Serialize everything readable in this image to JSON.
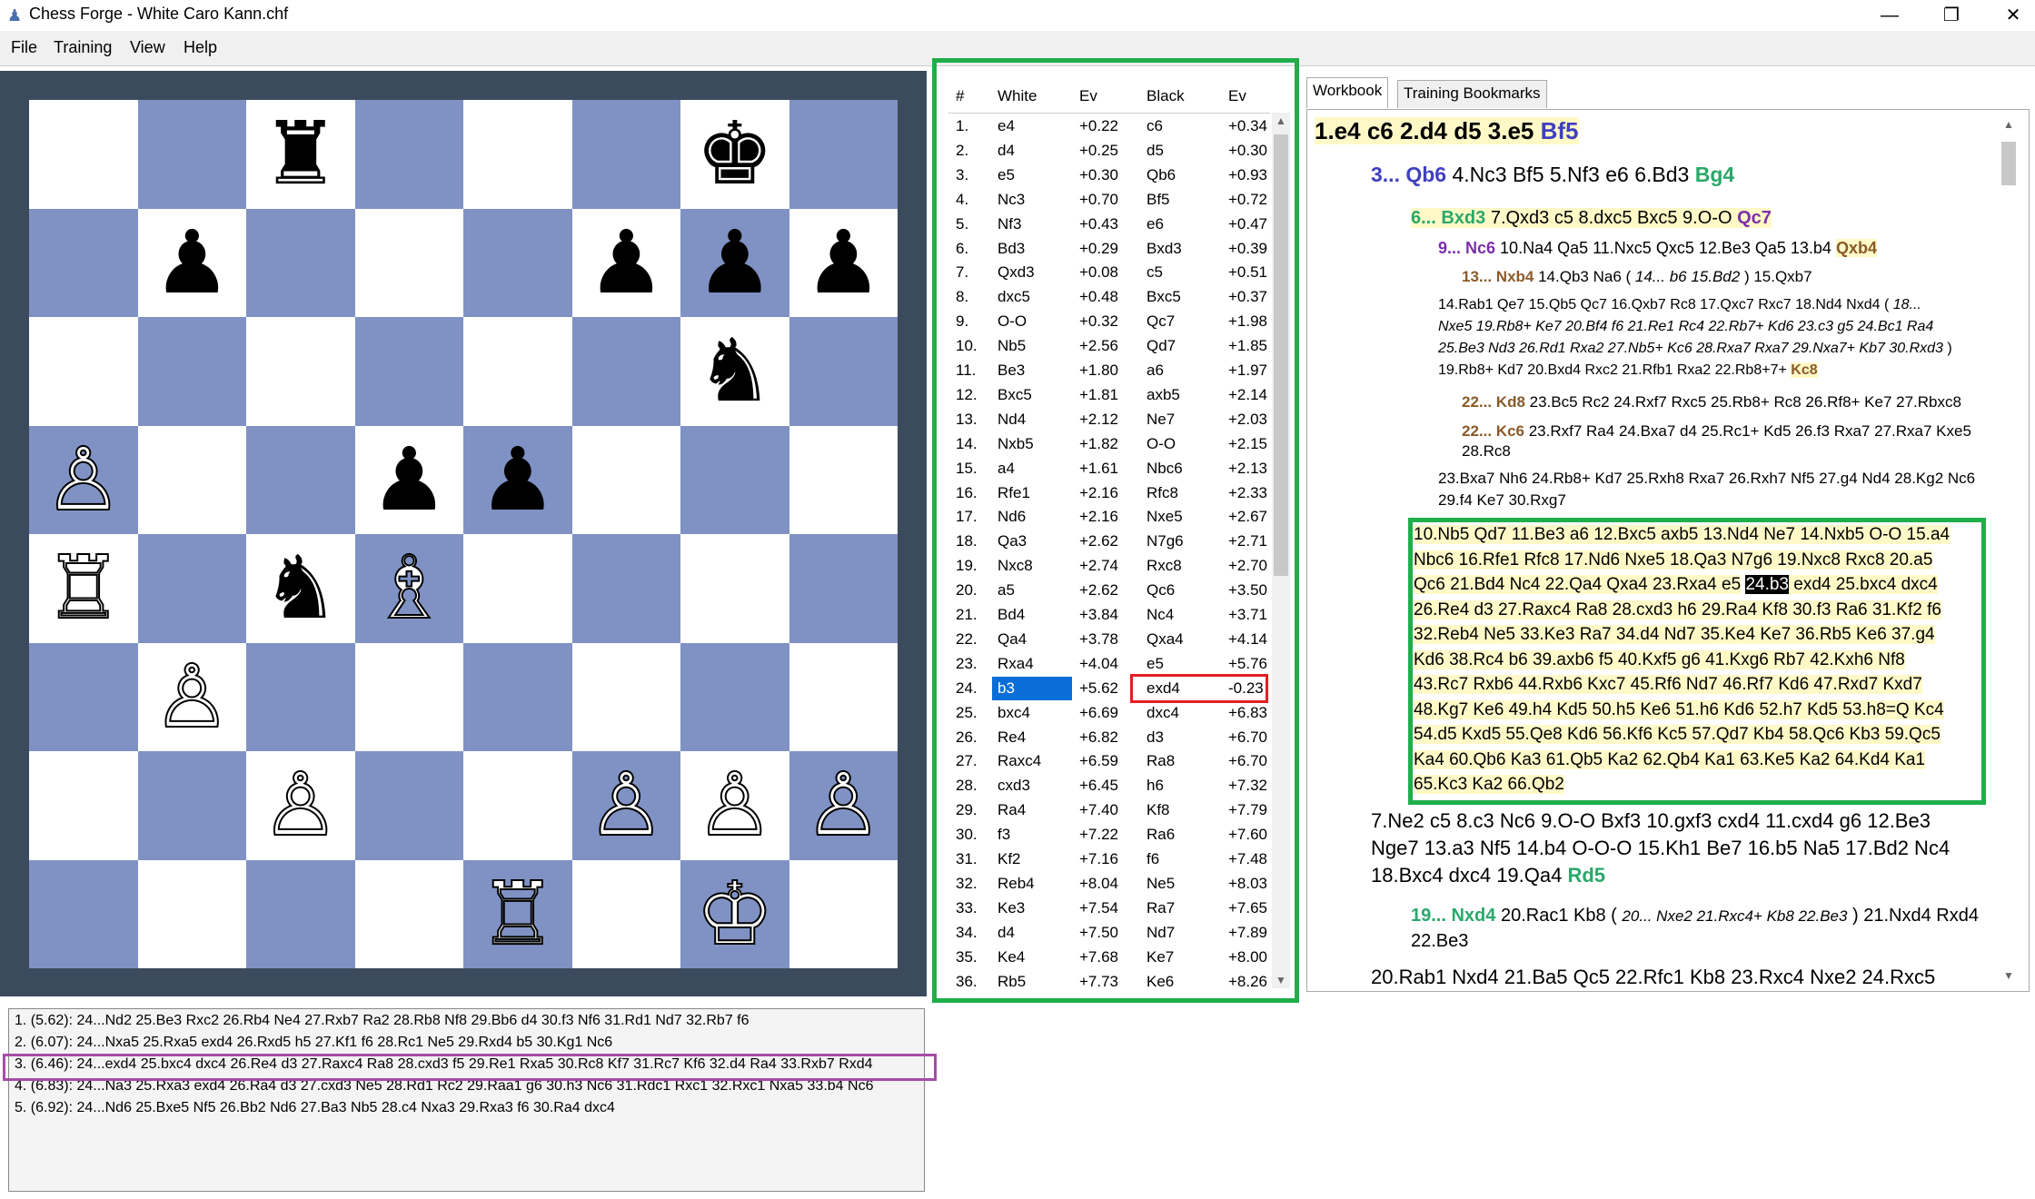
{
  "window": {
    "title": "Chess Forge - White Caro Kann.chf",
    "buttons": {
      "minimize": "—",
      "maximize": "❐",
      "close": "✕"
    }
  },
  "menu": [
    "File",
    "Training",
    "View",
    "Help"
  ],
  "board": {
    "light_color": "#ffffff",
    "dark_color": "#8092c4",
    "pieces": [
      {
        "sq": "c8",
        "glyph": "♜",
        "color": "b",
        "name": "black-rook"
      },
      {
        "sq": "g8",
        "glyph": "♚",
        "color": "b",
        "name": "black-king"
      },
      {
        "sq": "b7",
        "glyph": "♟",
        "color": "b",
        "name": "black-pawn"
      },
      {
        "sq": "f7",
        "glyph": "♟",
        "color": "b",
        "name": "black-pawn"
      },
      {
        "sq": "g7",
        "glyph": "♟",
        "color": "b",
        "name": "black-pawn"
      },
      {
        "sq": "h7",
        "glyph": "♟",
        "color": "b",
        "name": "black-pawn"
      },
      {
        "sq": "g6",
        "glyph": "♞",
        "color": "b",
        "name": "black-knight"
      },
      {
        "sq": "a5",
        "glyph": "♙",
        "color": "w",
        "name": "white-pawn"
      },
      {
        "sq": "d5",
        "glyph": "♟",
        "color": "b",
        "name": "black-pawn"
      },
      {
        "sq": "e5",
        "glyph": "♟",
        "color": "b",
        "name": "black-pawn"
      },
      {
        "sq": "a4",
        "glyph": "♖",
        "color": "w",
        "name": "white-rook"
      },
      {
        "sq": "c4",
        "glyph": "♞",
        "color": "b",
        "name": "black-knight"
      },
      {
        "sq": "d4",
        "glyph": "♗",
        "color": "w",
        "name": "white-bishop"
      },
      {
        "sq": "b3",
        "glyph": "♙",
        "color": "w",
        "name": "white-pawn"
      },
      {
        "sq": "c2",
        "glyph": "♙",
        "color": "w",
        "name": "white-pawn"
      },
      {
        "sq": "f2",
        "glyph": "♙",
        "color": "w",
        "name": "white-pawn"
      },
      {
        "sq": "g2",
        "glyph": "♙",
        "color": "w",
        "name": "white-pawn"
      },
      {
        "sq": "h2",
        "glyph": "♙",
        "color": "w",
        "name": "white-pawn"
      },
      {
        "sq": "e1",
        "glyph": "♖",
        "color": "w",
        "name": "white-rook"
      },
      {
        "sq": "g1",
        "glyph": "♔",
        "color": "w",
        "name": "white-king"
      }
    ]
  },
  "engine_lines": [
    "1. (5.62): 24...Nd2 25.Be3 Rxc2 26.Rb4 Ne4 27.Rxb7 Ra2 28.Rb8 Nf8 29.Bb6 d4 30.f3 Nf6 31.Rd1 Nd7 32.Rb7 f6",
    "2. (6.07): 24...Nxa5 25.Rxa5 exd4 26.Rxd5 h5 27.Kf1 f6 28.Rc1 Ne5 29.Rxd4 b5 30.Kg1 Nc6",
    "3. (6.46): 24...exd4 25.bxc4 dxc4 26.Re4 d3 27.Raxc4 Ra8 28.cxd3 f5 29.Re1 Rxa5 30.Rc8 Kf7 31.Rc7 Kf6 32.d4 Ra4 33.Rxb7 Rxd4",
    "4. (6.83): 24...Na3 25.Rxa3 exd4 26.Ra4 d3 27.cxd3 Ne5 28.Rd1 Rc2 29.Raa1 g6 30.h3 Nc6 31.Rdc1 Rxc1 32.Rxc1 Nxa5 33.b4 Nc6",
    "5. (6.92): 24...Nd6 25.Bxe5 Nf5 26.Bb2 Nd6 27.Ba3 Nb5 28.c4 Nxa3 29.Rxa3 f6 30.Ra4 dxc4"
  ],
  "moves_table": {
    "headers": [
      "#",
      "White",
      "Ev",
      "Black",
      "Ev"
    ],
    "rows": [
      [
        "1.",
        "e4",
        "+0.22",
        "c6",
        "+0.34"
      ],
      [
        "2.",
        "d4",
        "+0.25",
        "d5",
        "+0.30"
      ],
      [
        "3.",
        "e5",
        "+0.30",
        "Qb6",
        "+0.93"
      ],
      [
        "4.",
        "Nc3",
        "+0.70",
        "Bf5",
        "+0.72"
      ],
      [
        "5.",
        "Nf3",
        "+0.43",
        "e6",
        "+0.47"
      ],
      [
        "6.",
        "Bd3",
        "+0.29",
        "Bxd3",
        "+0.39"
      ],
      [
        "7.",
        "Qxd3",
        "+0.08",
        "c5",
        "+0.51"
      ],
      [
        "8.",
        "dxc5",
        "+0.48",
        "Bxc5",
        "+0.37"
      ],
      [
        "9.",
        "O-O",
        "+0.32",
        "Qc7",
        "+1.98"
      ],
      [
        "10.",
        "Nb5",
        "+2.56",
        "Qd7",
        "+1.85"
      ],
      [
        "11.",
        "Be3",
        "+1.80",
        "a6",
        "+1.97"
      ],
      [
        "12.",
        "Bxc5",
        "+1.81",
        "axb5",
        "+2.14"
      ],
      [
        "13.",
        "Nd4",
        "+2.12",
        "Ne7",
        "+2.03"
      ],
      [
        "14.",
        "Nxb5",
        "+1.82",
        "O-O",
        "+2.15"
      ],
      [
        "15.",
        "a4",
        "+1.61",
        "Nbc6",
        "+2.13"
      ],
      [
        "16.",
        "Rfe1",
        "+2.16",
        "Rfc8",
        "+2.33"
      ],
      [
        "17.",
        "Nd6",
        "+2.16",
        "Nxe5",
        "+2.67"
      ],
      [
        "18.",
        "Qa3",
        "+2.62",
        "N7g6",
        "+2.71"
      ],
      [
        "19.",
        "Nxc8",
        "+2.74",
        "Rxc8",
        "+2.70"
      ],
      [
        "20.",
        "a5",
        "+2.62",
        "Qc6",
        "+3.50"
      ],
      [
        "21.",
        "Bd4",
        "+3.84",
        "Nc4",
        "+3.71"
      ],
      [
        "22.",
        "Qa4",
        "+3.78",
        "Qxa4",
        "+4.14"
      ],
      [
        "23.",
        "Rxa4",
        "+4.04",
        "e5",
        "+5.76"
      ],
      [
        "24.",
        "b3",
        "+5.62",
        "exd4",
        "-0.23"
      ],
      [
        "25.",
        "bxc4",
        "+6.69",
        "dxc4",
        "+6.83"
      ],
      [
        "26.",
        "Re4",
        "+6.82",
        "d3",
        "+6.70"
      ],
      [
        "27.",
        "Raxc4",
        "+6.59",
        "Ra8",
        "+6.70"
      ],
      [
        "28.",
        "cxd3",
        "+6.45",
        "h6",
        "+7.32"
      ],
      [
        "29.",
        "Ra4",
        "+7.40",
        "Kf8",
        "+7.79"
      ],
      [
        "30.",
        "f3",
        "+7.22",
        "Ra6",
        "+7.60"
      ],
      [
        "31.",
        "Kf2",
        "+7.16",
        "f6",
        "+7.48"
      ],
      [
        "32.",
        "Reb4",
        "+8.04",
        "Ne5",
        "+8.03"
      ],
      [
        "33.",
        "Ke3",
        "+7.54",
        "Ra7",
        "+7.65"
      ],
      [
        "34.",
        "d4",
        "+7.50",
        "Nd7",
        "+7.89"
      ],
      [
        "35.",
        "Ke4",
        "+7.68",
        "Ke7",
        "+8.00"
      ],
      [
        "36.",
        "Rb5",
        "+7.73",
        "Ke6",
        "+8.26"
      ]
    ],
    "selected_row": 24,
    "selected_color": "#0a6ed8"
  },
  "tabs": [
    "Workbook",
    "Training Bookmarks"
  ],
  "workbook": {
    "line1_main": "1.e4 c6 2.d4 d5 3.e5 ",
    "line1_tail": "Bf5",
    "line2_head": "3... Qb6",
    "line2_mid": " 4.Nc3 Bf5 5.Nf3 e6 6.Bd3 ",
    "line2_tail": "Bg4",
    "line3_head": "6... Bxd3",
    "line3_mid": " 7.Qxd3 c5 8.dxc5 Bxc5 9.O-O ",
    "line3_tail": "Qc7",
    "line4_head": "9... Nc6",
    "line4_mid": " 10.Na4 Qa5 11.Nxc5 Qxc5 12.Be3 Qa5 13.b4 ",
    "line4_tail": "Qxb4",
    "line5_head": "13... Nxb4",
    "line5_mid": " 14.Qb3 Na6 ( ",
    "line5_it": "14... b6 15.Bd2",
    "line5_end": " ) 15.Qxb7",
    "line6": "14.Rab1 Qe7 15.Qb5 Qc7 16.Qxb7 Rc8 17.Qxc7 Rxc7 18.Nd4 Nxd4 ( ",
    "line6_it": "18...",
    "line7_it": "Nxe5 19.Rb8+ Ke7 20.Bf4 f6 21.Re1 Rc4 22.Rb7+ Kd6 23.c3 g5 24.Bc1 Ra4",
    "line8_it": "25.Be3 Nd3 26.Rd1 Rxa2 27.Nb5+ Kc6 28.Rxa7 Rxa7 29.Nxa7+ Kb7 30.Rxd3",
    "line8_end": " )",
    "line9_mid": "19.Rb8+ Kd7 20.Bxd4 Rxc2 21.Rfb1 Rxa2 22.Rb8+7+ ",
    "line9_tail": "Kc8",
    "line10_head": "22... Kd8",
    "line10_mid": " 23.Bc5 Rc2 24.Rxf7 Rxc5 25.Rb8+ Rc8 26.Rf8+ Ke7 27.Rbxc8",
    "line11_head": "22... Kc6",
    "line11_mid": " 23.Rxf7 Ra4 24.Bxa7 d4 25.Rc1+ Kd5 26.f3 Rxa7 27.Rxa7 Kxe5",
    "line12": "28.Rc8",
    "line13": "23.Bxa7 Nh6 24.Rb8+ Kd7 25.Rxh8 Rxa7 26.Rxh7 Nf5 27.g4 Nd4 28.Kg2 Nc6",
    "line14": "29.f4 Ke7 30.Rxg7",
    "main_lines": [
      "10.Nb5 Qd7 11.Be3 a6 12.Bxc5 axb5 13.Nd4 Ne7 14.Nxb5 O-O 15.a4",
      "Nbc6 16.Rfe1 Rfc8 17.Nd6 Nxe5 18.Qa3 N7g6 19.Nxc8 Rxc8 20.a5",
      "Qc6 21.Bd4 Nc4 22.Qa4 Qxa4 23.Rxa4 e5",
      "26.Re4 d3 27.Raxc4 Ra8 28.cxd3 h6 29.Ra4 Kf8 30.f3 Ra6 31.Kf2 f6",
      "32.Reb4 Ne5 33.Ke3 Ra7 34.d4 Nd7 35.Ke4 Ke7 36.Rb5 Ke6 37.g4",
      "Kd6 38.Rc4 b6 39.axb6 f5 40.Kxf5 g6 41.Kxg6 Rb7 42.Kxh6 Nf8",
      "43.Rc7 Rxb6 44.Rxb6 Kxc7 45.Rf6 Nd7 46.Rf7 Kd6 47.Rxd7 Kxd7",
      "48.Kg7 Ke6 49.h4 Kd5 50.h5 Ke6 51.h6 Kd6 52.h7 Kd5 53.h8=Q Kc4",
      "54.d5 Kxd5 55.Qe8 Kd6 56.Kf6 Kc5 57.Qd7 Kb4 58.Qc6 Kb3 59.Qc5",
      "Ka4 60.Qb6 Ka3 61.Qb5 Ka2 62.Qb4 Ka1 63.Ke5 Ka2 64.Kd4 Ka1",
      "65.Kc3 Ka2 66.Qb2"
    ],
    "current_move": "24.b3",
    "main_line3_after": " exd4 25.bxc4 dxc4",
    "line_a": "7.Ne2 c5 8.c3 Nc6 9.O-O Bxf3 10.gxf3 cxd4 11.cxd4 g6 12.Be3",
    "line_b": "Nge7 13.a3 Nf5 14.b4 O-O-O 15.Kh1 Be7 16.b5 Na5 17.Bd2 Nc4",
    "line_c_mid": "18.Bxc4 dxc4 19.Qa4 ",
    "line_c_tail": "Rd5",
    "line_d_head": "19... Nxd4",
    "line_d_mid": " 20.Rac1 Kb8 ( ",
    "line_d_it": "20... Nxe2 21.Rxc4+ Kb8 22.Be3",
    "line_d_end": " ) 21.Nxd4 Rxd4",
    "line_e": "22.Be3",
    "line_f": "20.Rab1 Nxd4 21.Ba5 Qc5 22.Rfc1 Kb8 23.Rxc4 Nxe2 24.Rxc5"
  }
}
